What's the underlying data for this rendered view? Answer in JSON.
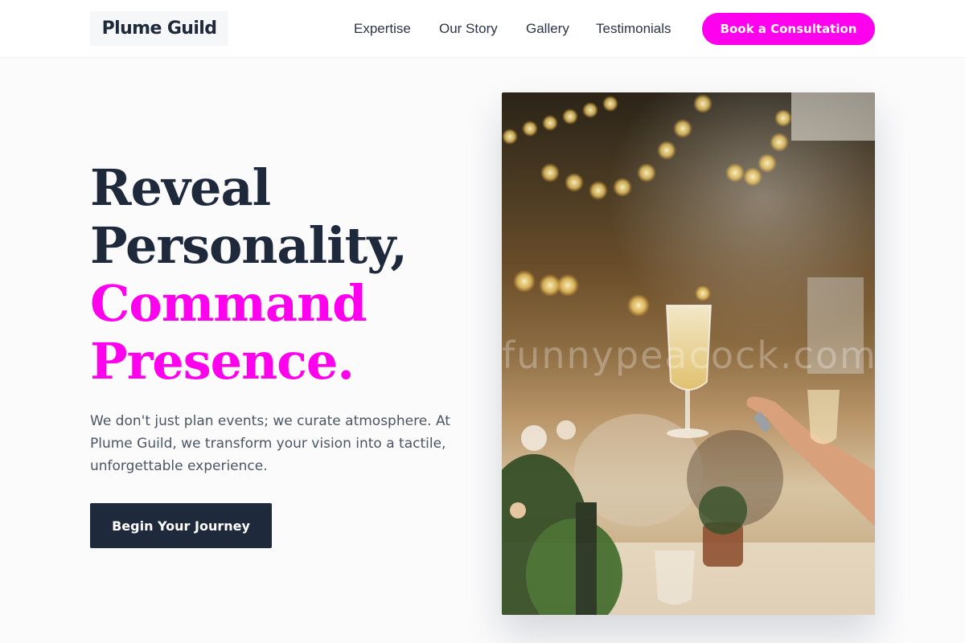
{
  "header": {
    "logo": "Plume Guild",
    "nav": [
      "Expertise",
      "Our Story",
      "Gallery",
      "Testimonials"
    ],
    "cta_label": "Book a Consultation"
  },
  "hero": {
    "headline_dark": [
      "Reveal",
      "Personality,"
    ],
    "headline_accent": [
      "Command",
      "Presence."
    ],
    "lede": "We don't just plan events; we curate atmosphere. At Plume Guild, we transform your vision into a tactile, unforgettable experience.",
    "button_label": "Begin Your Journey"
  },
  "photo": {
    "subject": "champagne-toast-at-reception-photo",
    "watermark": "funnypeacock.com"
  },
  "colors": {
    "brand_dark": "#1e293b",
    "accent_magenta": "#ff00ee",
    "background": "#fbfbfc"
  }
}
